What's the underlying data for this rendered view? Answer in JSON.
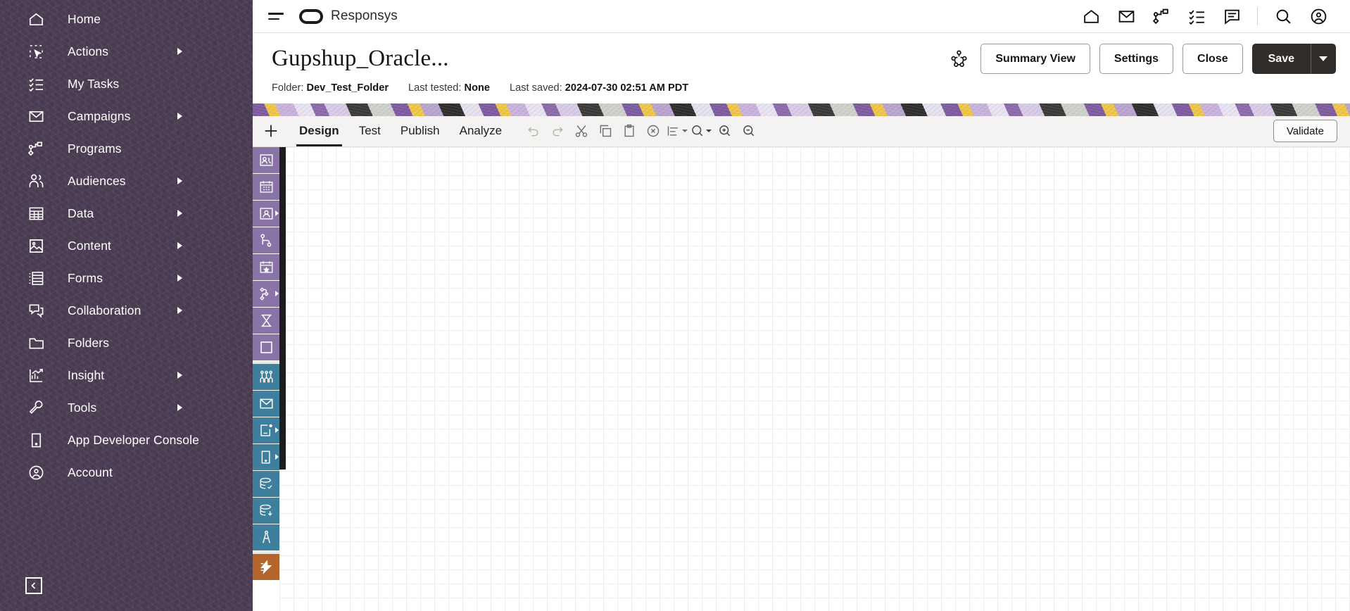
{
  "sidebar": {
    "items": [
      {
        "label": "Home",
        "icon": "home-icon",
        "has_submenu": false
      },
      {
        "label": "Actions",
        "icon": "cursor-select-icon",
        "has_submenu": true
      },
      {
        "label": "My Tasks",
        "icon": "checklist-icon",
        "has_submenu": false
      },
      {
        "label": "Campaigns",
        "icon": "envelope-icon",
        "has_submenu": true
      },
      {
        "label": "Programs",
        "icon": "program-flow-icon",
        "has_submenu": false
      },
      {
        "label": "Audiences",
        "icon": "people-icon",
        "has_submenu": true
      },
      {
        "label": "Data",
        "icon": "table-grid-icon",
        "has_submenu": true
      },
      {
        "label": "Content",
        "icon": "image-icon",
        "has_submenu": true
      },
      {
        "label": "Forms",
        "icon": "form-list-icon",
        "has_submenu": true
      },
      {
        "label": "Collaboration",
        "icon": "chat-bubbles-icon",
        "has_submenu": true
      },
      {
        "label": "Folders",
        "icon": "folder-icon",
        "has_submenu": false
      },
      {
        "label": "Insight",
        "icon": "chart-insight-icon",
        "has_submenu": true
      },
      {
        "label": "Tools",
        "icon": "wrench-icon",
        "has_submenu": true
      },
      {
        "label": "App Developer Console",
        "icon": "device-console-icon",
        "has_submenu": false
      },
      {
        "label": "Account",
        "icon": "user-circle-icon",
        "has_submenu": false
      }
    ],
    "collapse_icon": "chevron-left-icon",
    "background_color": "#4b3b52"
  },
  "topbar": {
    "menu_icon": "hamburger-icon",
    "logo_icon": "oracle-logo-icon",
    "brand": "Responsys",
    "icons": [
      {
        "name": "home-icon"
      },
      {
        "name": "envelope-icon"
      },
      {
        "name": "programs-icon"
      },
      {
        "name": "tasks-checklist-icon"
      },
      {
        "name": "chat-icon"
      },
      {
        "name": "search-icon"
      },
      {
        "name": "account-icon"
      }
    ]
  },
  "header": {
    "title": "Gupshup_Oracle...",
    "meta": [
      {
        "key": "Folder:",
        "value": "Dev_Test_Folder"
      },
      {
        "key": "Last tested:",
        "value": "None"
      },
      {
        "key": "Last saved:",
        "value": "2024-07-30 02:51 AM PDT"
      }
    ],
    "share_icon": "org-share-icon",
    "buttons": {
      "summary_view": "Summary View",
      "settings": "Settings",
      "close": "Close",
      "save": "Save",
      "save_dropdown_icon": "caret-down-icon"
    }
  },
  "toolstrip": {
    "add_icon": "plus-icon",
    "tabs": [
      {
        "label": "Design",
        "active": true
      },
      {
        "label": "Test",
        "active": false
      },
      {
        "label": "Publish",
        "active": false
      },
      {
        "label": "Analyze",
        "active": false
      }
    ],
    "icons": [
      {
        "name": "undo-icon",
        "disabled": true
      },
      {
        "name": "redo-icon",
        "disabled": true
      },
      {
        "name": "cut-icon",
        "disabled": false
      },
      {
        "name": "copy-icon",
        "disabled": false
      },
      {
        "name": "paste-icon",
        "disabled": false
      },
      {
        "name": "delete-circle-icon",
        "disabled": false
      },
      {
        "name": "align-icon",
        "disabled": false
      },
      {
        "name": "search-dropdown-icon",
        "disabled": false
      },
      {
        "name": "zoom-in-icon",
        "disabled": false
      },
      {
        "name": "zoom-out-icon",
        "disabled": false
      }
    ],
    "validate_label": "Validate"
  },
  "rail": {
    "items": [
      {
        "name": "audience-stage-icon",
        "group": "purple",
        "has_submenu": false
      },
      {
        "name": "calendar-stage-icon",
        "group": "purple",
        "has_submenu": false
      },
      {
        "name": "profile-stage-icon",
        "group": "purple",
        "has_submenu": true
      },
      {
        "name": "branch-split-icon",
        "group": "purple",
        "has_submenu": false
      },
      {
        "name": "event-calendar-icon",
        "group": "purple",
        "has_submenu": false
      },
      {
        "name": "decision-node-icon",
        "group": "purple",
        "has_submenu": true
      },
      {
        "name": "wait-hourglass-icon",
        "group": "purple",
        "has_submenu": false
      },
      {
        "name": "stage-box-icon",
        "group": "purple",
        "has_submenu": false
      },
      {
        "name": "split-test-icon",
        "group": "teal",
        "has_submenu": false
      },
      {
        "name": "email-message-icon",
        "group": "teal",
        "has_submenu": false
      },
      {
        "name": "push-message-icon",
        "group": "teal",
        "has_submenu": true
      },
      {
        "name": "mobile-message-icon",
        "group": "teal",
        "has_submenu": true
      },
      {
        "name": "data-check-icon",
        "group": "teal",
        "has_submenu": false
      },
      {
        "name": "data-load-icon",
        "group": "teal",
        "has_submenu": false
      },
      {
        "name": "compass-icon",
        "group": "teal",
        "has_submenu": false
      },
      {
        "name": "custom-event-icon",
        "group": "orange",
        "has_submenu": false
      }
    ],
    "scrollbar": "rail-scrollbar"
  },
  "colors": {
    "sidebar_purple": "#4b3b52",
    "rail_purple": "#8a73a6",
    "rail_teal": "#3d7f9c",
    "rail_orange": "#b4652c",
    "save_dark": "#312d2b",
    "accent_yellow": "#f0c64a"
  }
}
